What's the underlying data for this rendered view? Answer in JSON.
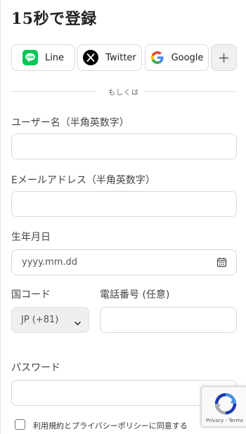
{
  "page": {
    "title": "15秒で登録"
  },
  "social": {
    "line_label": "Line",
    "twitter_label": "Twitter",
    "google_label": "Google",
    "more_label": "+",
    "line_color": "#06C755",
    "twitter_color": "#000000"
  },
  "divider": {
    "text": "もしくは"
  },
  "form": {
    "username_label": "ユーザー名（半角英数字）",
    "email_label": "Eメールアドレス（半角英数字）",
    "birthday_label": "生年月日",
    "birthday_placeholder": "yyyy.mm.dd",
    "country_code_label": "国コード",
    "country_code_value": "JP (+81)",
    "phone_label": "電話番号 (任意)",
    "password_label": "パスワード",
    "agree_text": "利用規約とプライバシーポリシーに同意する"
  },
  "recaptcha": {
    "links_text": "Privacy - Terms"
  },
  "colors": {
    "border": "#d6d6d6",
    "select_bg": "#efefef",
    "label": "#444444"
  }
}
